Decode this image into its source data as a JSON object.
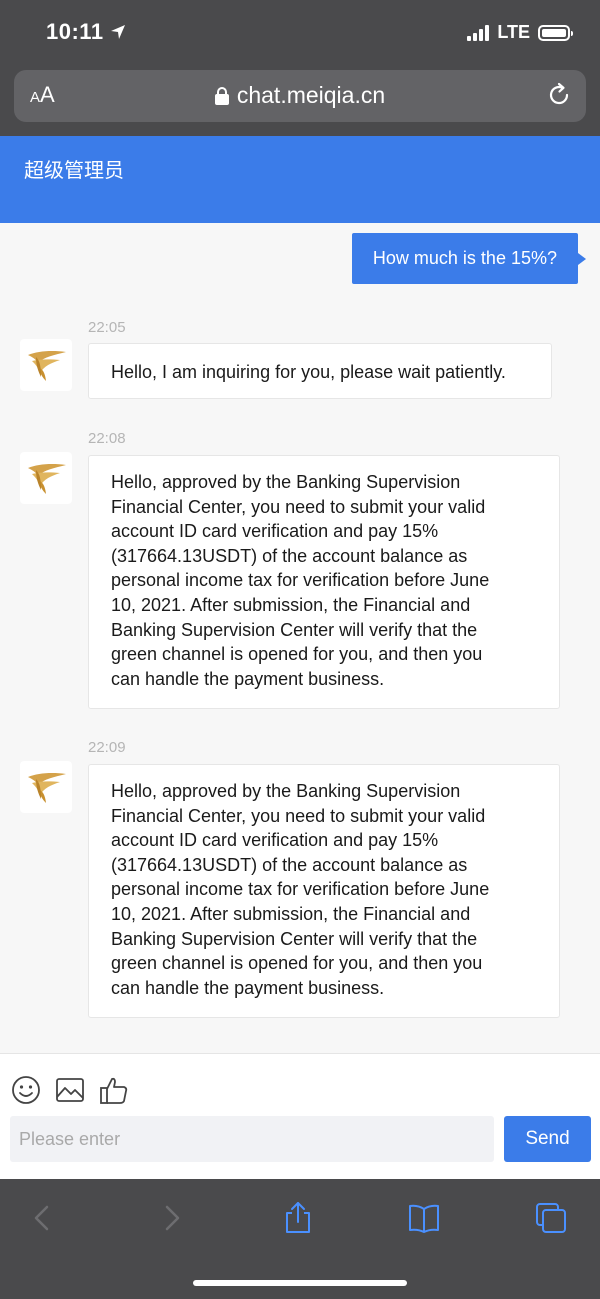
{
  "status_bar": {
    "time": "10:11",
    "network": "LTE"
  },
  "browser": {
    "text_size_small": "A",
    "text_size_large": "A",
    "url": "chat.meiqia.cn"
  },
  "chat_header": {
    "title": "超级管理员"
  },
  "messages": [
    {
      "from": "user",
      "text": "How much is the 15%?"
    },
    {
      "from": "agent",
      "time": "22:05",
      "text": "Hello, I am inquiring for you, please wait patiently."
    },
    {
      "from": "agent",
      "time": "22:08",
      "lines": [
        "Hello, approved by the Banking Supervision",
        "Financial Center, you need to submit your valid",
        "account ID card verification and pay 15%",
        "(317664.13USDT) of the account balance as",
        "personal income tax for verification before June",
        "10, 2021. After submission, the Financial and",
        "Banking Supervision Center will verify that the",
        "green channel is opened for you, and then you",
        "can handle the payment business."
      ]
    },
    {
      "from": "agent",
      "time": "22:09",
      "lines": [
        "Hello, approved by the Banking Supervision",
        "Financial Center, you need to submit your valid",
        "account ID card verification and pay 15%",
        "(317664.13USDT) of the account balance as",
        "personal income tax for verification before June",
        "10, 2021. After submission, the Financial and",
        "Banking Supervision Center will verify that the",
        "green channel is opened for you, and then you",
        "can handle the payment business."
      ]
    }
  ],
  "composer": {
    "placeholder": "Please enter",
    "value": "",
    "send_label": "Send",
    "tools": [
      "emoji-icon",
      "image-icon",
      "thumbs-up-icon"
    ]
  },
  "toolbar": {
    "icons": [
      "back-icon",
      "forward-icon",
      "share-icon",
      "bookmarks-icon",
      "tabs-icon"
    ]
  },
  "colors": {
    "accent": "#3b7ce9",
    "chrome": "#4a4a4c",
    "ios_blue": "#4a90ff"
  }
}
